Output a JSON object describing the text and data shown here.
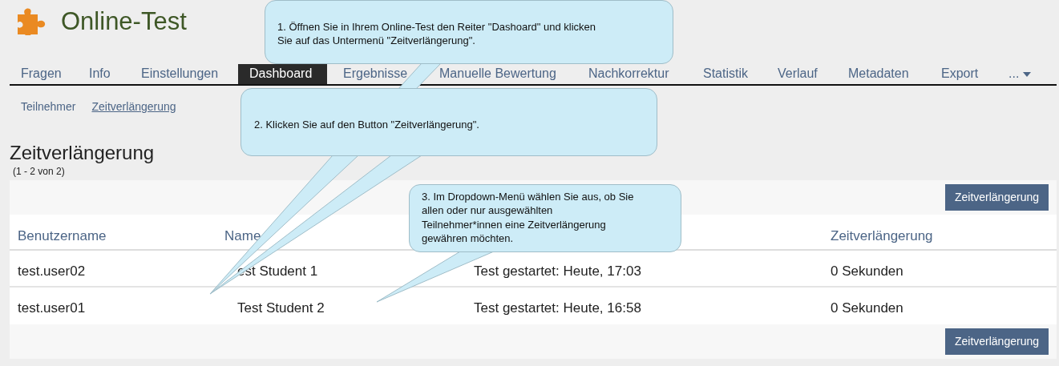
{
  "app": {
    "title": "Online-Test"
  },
  "tabs": [
    {
      "label": "Fragen",
      "selected": false,
      "kind": "tab"
    },
    {
      "label": "Info",
      "selected": false,
      "kind": "tab"
    },
    {
      "label": "Einstellungen",
      "selected": false,
      "kind": "tab"
    },
    {
      "label": "Dashboard",
      "selected": true,
      "kind": "tab"
    },
    {
      "label": "Ergebnisse",
      "selected": false,
      "kind": "tab"
    },
    {
      "label": "Manuelle Bewertung",
      "selected": false,
      "kind": "tab"
    },
    {
      "label": "Nachkorrektur",
      "selected": false,
      "kind": "tab"
    },
    {
      "label": "Statistik",
      "selected": false,
      "kind": "tab"
    },
    {
      "label": "Verlauf",
      "selected": false,
      "kind": "tab"
    },
    {
      "label": "Metadaten",
      "selected": false,
      "kind": "tab"
    },
    {
      "label": "Export",
      "selected": false,
      "kind": "tab"
    },
    {
      "label": "...",
      "selected": false,
      "kind": "menu"
    }
  ],
  "subtabs": [
    {
      "label": "Teilnehmer",
      "selected": false
    },
    {
      "label": "Zeitverlängerung",
      "selected": true
    }
  ],
  "heading": "Zeitverlängerung",
  "count": "(1 - 2 von 2)",
  "table": {
    "top_button": "Zeitverlängerung",
    "columns": [
      "Benutzername",
      "Name",
      null,
      "Zeitverlängerung"
    ],
    "rows": [
      {
        "cells": [
          "test.user02",
          "est Student 1",
          "Test gestartet: Heute, 17:03",
          "0 Sekunden"
        ]
      },
      {
        "cells": [
          "test.user01",
          "Test Student 2",
          "Test gestartet: Heute, 16:58",
          "0 Sekunden"
        ]
      }
    ],
    "bottom_button": "Zeitverlängerung"
  },
  "callouts": [
    {
      "lines": [
        "1. Öffnen Sie in Ihrem Online-Test den Reiter \"Dashoard\" und klicken",
        "Sie auf das Untermenü \"Zeitverlängerung\"."
      ]
    },
    {
      "lines": [
        "2. Klicken Sie auf den Button \"Zeitverlängerung\"."
      ]
    },
    {
      "lines": [
        "3. Im Dropdown-Menü wählen Sie aus, ob Sie",
        "allen oder nur ausgewählten",
        "Teilnehmer*innen eine Zeitverlängerung",
        "gewähren möchten."
      ]
    }
  ]
}
